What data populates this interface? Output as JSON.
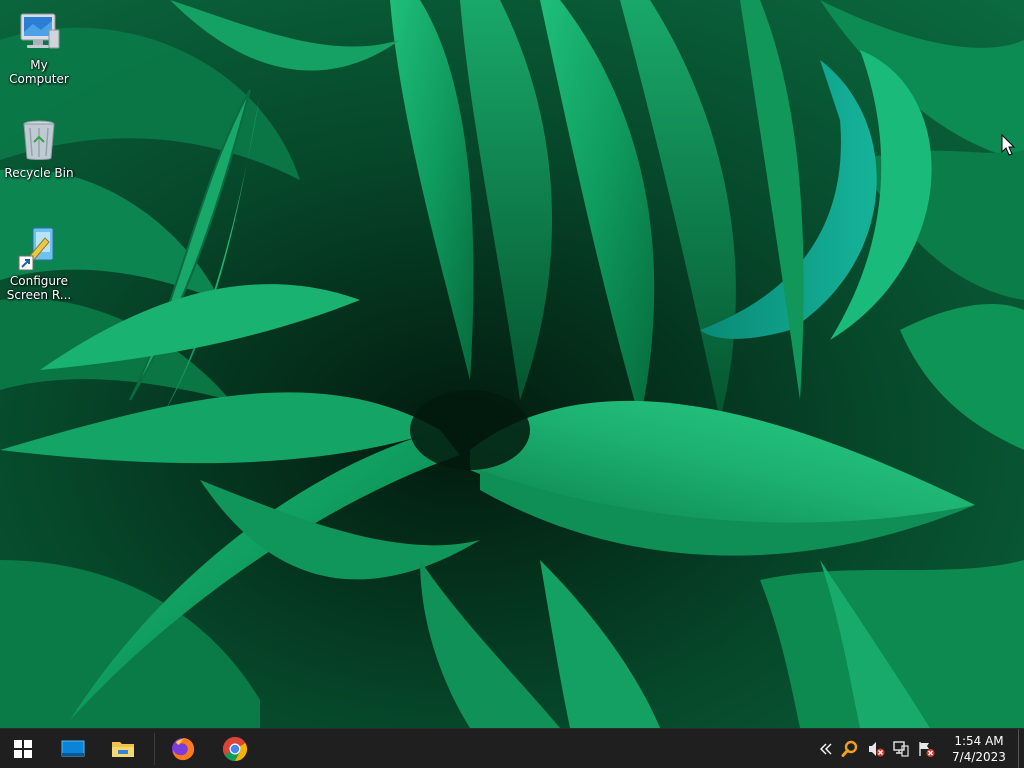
{
  "desktop": {
    "icons": [
      {
        "label": "My Computer",
        "icon": "computer-icon"
      },
      {
        "label": "Recycle Bin",
        "icon": "recycle-bin-icon"
      },
      {
        "label": "Configure\nScreen R...",
        "icon": "configure-shortcut-icon"
      }
    ]
  },
  "taskbar": {
    "pinned": [
      {
        "icon": "start-icon"
      },
      {
        "icon": "desktop-window-icon"
      },
      {
        "icon": "file-explorer-icon"
      },
      {
        "icon": "firefox-icon"
      },
      {
        "icon": "chrome-icon"
      }
    ],
    "tray": [
      {
        "icon": "chevron-left-icon"
      },
      {
        "icon": "search-icon"
      },
      {
        "icon": "speaker-muted-icon"
      },
      {
        "icon": "network-disconnected-icon"
      },
      {
        "icon": "action-center-alert-icon"
      }
    ],
    "clock": {
      "time": "1:54 AM",
      "date": "7/4/2023"
    }
  },
  "colors": {
    "taskbar_bg": "#1f1f1f",
    "accent_blue": "#0a84d8",
    "folder_yellow": "#f2c14e",
    "leaf_green": "#0e8f55"
  }
}
